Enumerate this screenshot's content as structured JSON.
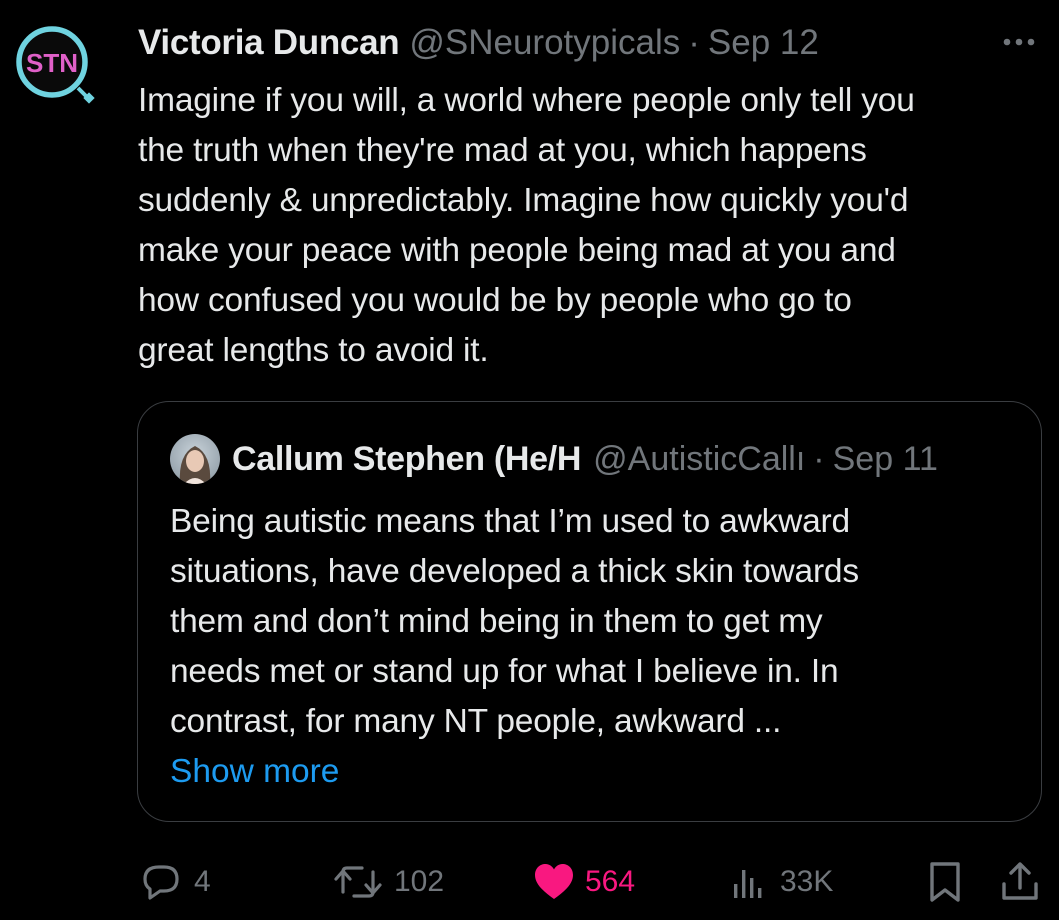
{
  "tweet": {
    "avatar_text": "STN",
    "author_name": "Victoria Duncan",
    "author_handle": "@SNeurotypicals",
    "separator": "·",
    "date": "Sep 12",
    "body_lines": [
      "Imagine if you will, a world where people only tell you",
      "the truth when they're mad at you, which happens",
      "suddenly & unpredictably. Imagine how quickly you'd",
      "make your peace with people being mad at you and",
      "how confused you would be by people who go to",
      "great lengths to avoid it."
    ]
  },
  "quote": {
    "author_name": "Callum Stephen (He/H",
    "author_handle": "@AutisticCallı",
    "separator": "·",
    "date": "Sep 11",
    "body_lines": [
      "Being autistic means that I’m used to awkward",
      "situations, have developed a thick skin towards",
      "them and don’t mind being in them to get my",
      "needs met or stand up for what I believe in. In",
      "contrast, for many NT people, awkward ..."
    ],
    "show_more": "Show more"
  },
  "actions": {
    "replies": "4",
    "reposts": "102",
    "likes": "564",
    "views": "33K"
  },
  "colors": {
    "background": "#000000",
    "text": "#e7e9ea",
    "muted": "#71767b",
    "link": "#1d9bf0",
    "like": "#f91880",
    "avatar_ring": "#6fd3e0",
    "avatar_text": "#e060c8"
  },
  "icons": [
    "more-icon",
    "reply-icon",
    "repost-icon",
    "heart-icon",
    "views-icon",
    "bookmark-icon",
    "share-icon"
  ]
}
